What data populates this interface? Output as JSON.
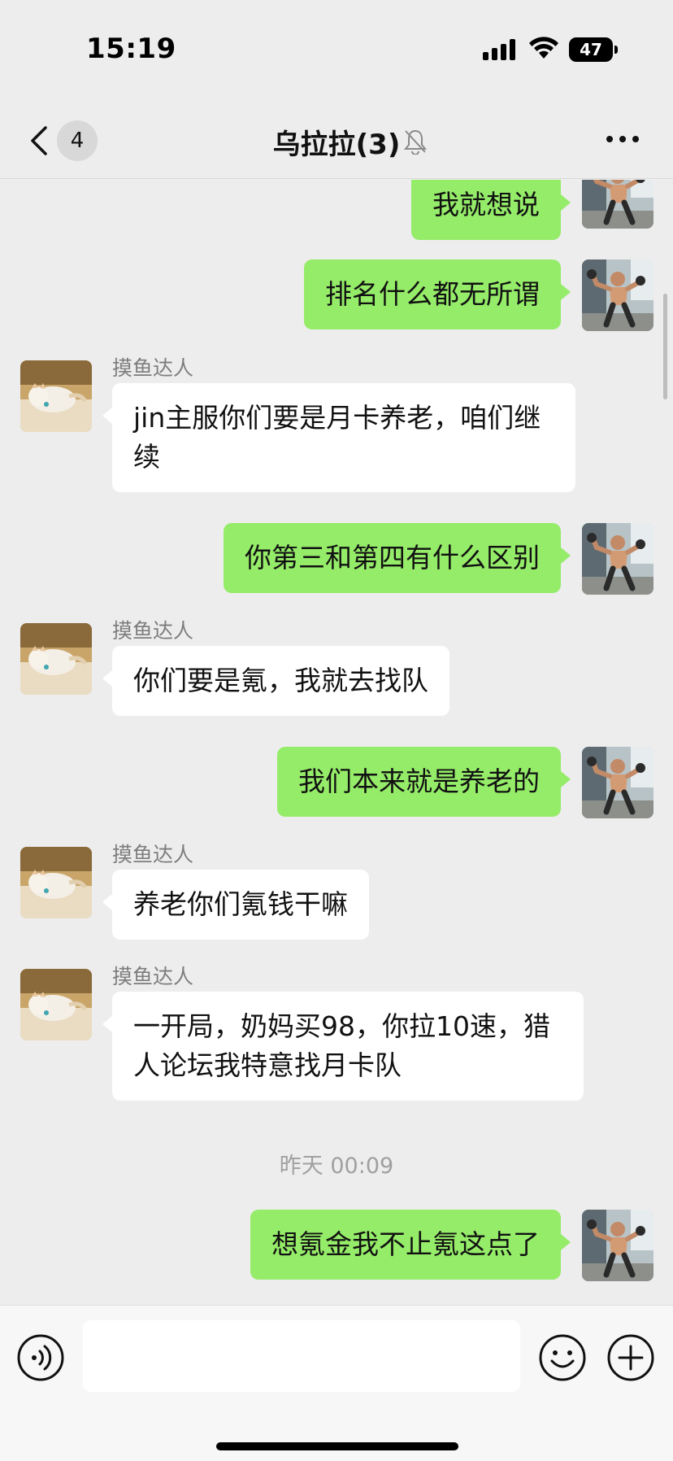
{
  "status_bar": {
    "time": "15:19",
    "battery": "47"
  },
  "nav": {
    "back_badge": "4",
    "title": "乌拉拉(3)"
  },
  "chat": {
    "incoming_sender": "摸鱼达人",
    "messages": [
      {
        "text": "我就想说"
      },
      {
        "text": "排名什么都无所谓"
      },
      {
        "sender": "摸鱼达人",
        "text": "jin主服你们要是月卡养老，咱们继续"
      },
      {
        "text": "你第三和第四有什么区别"
      },
      {
        "sender": "摸鱼达人",
        "text": "你们要是氪，我就去找队"
      },
      {
        "text": "我们本来就是养老的"
      },
      {
        "sender": "摸鱼达人",
        "text": "养老你们氪钱干嘛"
      },
      {
        "sender": "摸鱼达人",
        "text": "一开局，奶妈买98，你拉10速，猎人论坛我特意找月卡队"
      },
      {
        "text": "想氪金我不止氪这点了"
      }
    ],
    "timestamp": "昨天 00:09"
  },
  "input_bar": {
    "placeholder": ""
  }
}
